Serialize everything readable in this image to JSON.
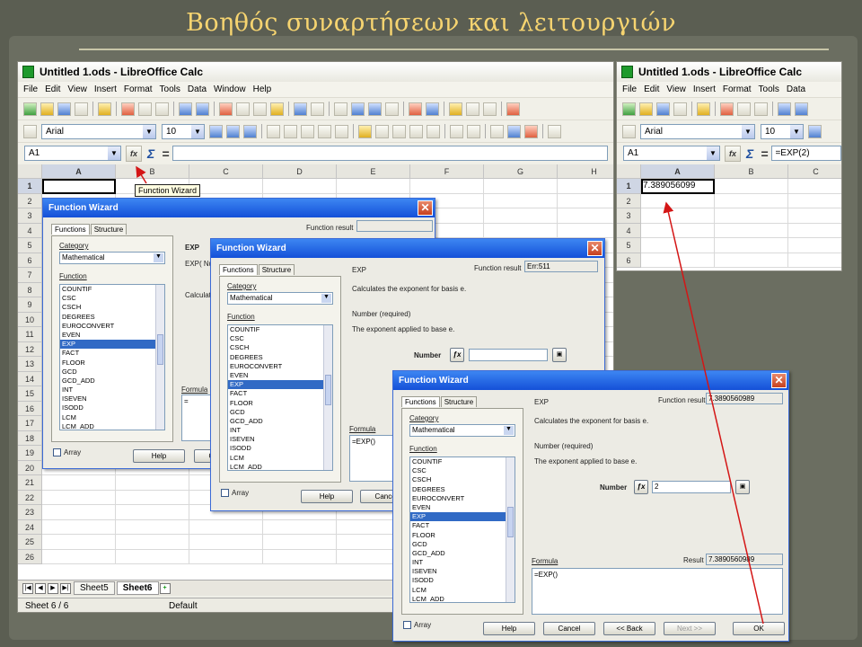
{
  "slide_title": "Βοηθός συναρτήσεων και λειτουργιών",
  "main_window": {
    "title": "Untitled 1.ods - LibreOffice Calc",
    "menu": [
      "File",
      "Edit",
      "View",
      "Insert",
      "Format",
      "Tools",
      "Data",
      "Window",
      "Help"
    ],
    "font_name": "Arial",
    "font_size": "10",
    "name_box": "A1",
    "columns": [
      "A",
      "B",
      "C",
      "D",
      "E",
      "F",
      "G",
      "H"
    ],
    "rows": [
      "1",
      "2",
      "3",
      "4",
      "5",
      "6",
      "7",
      "8",
      "9",
      "10",
      "11",
      "12",
      "13",
      "14",
      "15",
      "16",
      "17",
      "18",
      "19",
      "20",
      "21",
      "22",
      "23",
      "24",
      "25",
      "26"
    ],
    "tooltip": "Function Wizard",
    "sheet_tabs": [
      "Sheet5",
      "Sheet6"
    ],
    "status_sheet": "Sheet 6 / 6",
    "status_style": "Default"
  },
  "right_window": {
    "title": "Untitled 1.ods - LibreOffice Calc",
    "menu": [
      "File",
      "Edit",
      "View",
      "Insert",
      "Format",
      "Tools",
      "Data"
    ],
    "font_name": "Arial",
    "font_size": "10",
    "name_box": "A1",
    "formula": "=EXP(2)",
    "columns": [
      "A",
      "B",
      "C"
    ],
    "rows": [
      "1",
      "2",
      "3",
      "4",
      "5",
      "6"
    ],
    "cell_a1": "7.389056099"
  },
  "dialog": {
    "title": "Function Wizard",
    "tab_functions": "Functions",
    "tab_structure": "Structure",
    "category_label": "Category",
    "category_value": "Mathematical",
    "function_label": "Function",
    "functions": [
      "COUNTIF",
      "CSC",
      "CSCH",
      "DEGREES",
      "EUROCONVERT",
      "EVEN",
      "EXP",
      "FACT",
      "FLOOR",
      "GCD",
      "GCD_ADD",
      "INT",
      "ISEVEN",
      "ISODD",
      "LCM",
      "LCM_ADD"
    ],
    "selected_function": "EXP",
    "function_result_label": "Function result",
    "array_label": "Array",
    "help": "Help",
    "cancel": "Cancel",
    "back": "<< Back",
    "next": "Next >>",
    "ok": "OK",
    "formula_label": "Formula",
    "result_label": "Result",
    "fn_name": "EXP",
    "fn_desc": "Calculates the exponent for basis e.",
    "arg_desc_title": "Number (required)",
    "arg_desc": "The exponent applied to base e.",
    "arg_label": "Number"
  },
  "dialog1": {
    "fn_head": "EXP",
    "fn_sig": "EXP( Nu",
    "calc": "Calculate",
    "formula_text": "="
  },
  "dialog2": {
    "result": "Err:511",
    "formula_text": "=EXP()",
    "arg_value": ""
  },
  "dialog3": {
    "result": "7.3890560989",
    "formula_text": "=EXP()",
    "arg_value": "2",
    "result_bottom": "7.3890560989"
  }
}
